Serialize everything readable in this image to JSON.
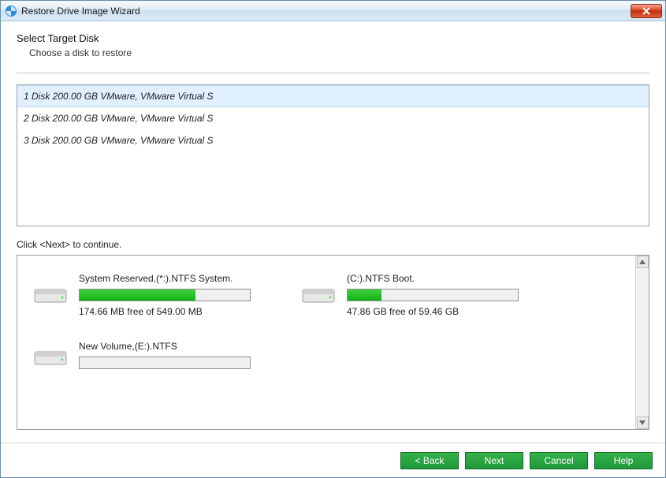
{
  "window": {
    "title": "Restore Drive Image Wizard"
  },
  "header": {
    "title": "Select Target Disk",
    "subtitle": "Choose a disk to restore"
  },
  "disks": [
    {
      "label": "1 Disk 200.00 GB VMware,  VMware Virtual S",
      "selected": true
    },
    {
      "label": "2 Disk 200.00 GB VMware,  VMware Virtual S",
      "selected": false
    },
    {
      "label": "3 Disk 200.00 GB VMware,  VMware Virtual S",
      "selected": false
    }
  ],
  "instruction": "Click <Next> to continue.",
  "partitions": [
    {
      "label": "System Reserved,(*:).NTFS System.",
      "free_text": "174.66 MB free of 549.00 MB",
      "fill_pct": 68
    },
    {
      "label": "(C:).NTFS Boot.",
      "free_text": "47.86 GB free of 59.46 GB",
      "fill_pct": 20
    },
    {
      "label": "New Volume,(E:).NTFS",
      "free_text": "",
      "fill_pct": 0
    }
  ],
  "buttons": {
    "back": "< Back",
    "next": "Next",
    "cancel": "Cancel",
    "help": "Help"
  },
  "colors": {
    "accent_green": "#22a33c",
    "selection_bg": "#e0f0ff"
  }
}
